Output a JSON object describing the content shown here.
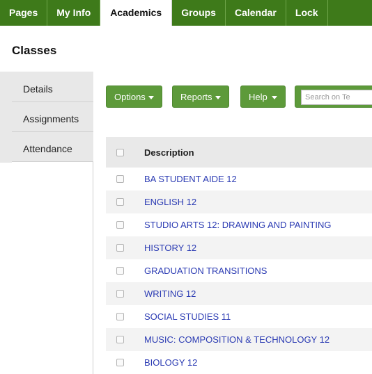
{
  "nav": {
    "tabs": [
      {
        "label": "Pages"
      },
      {
        "label": "My Info"
      },
      {
        "label": "Academics"
      },
      {
        "label": "Groups"
      },
      {
        "label": "Calendar"
      },
      {
        "label": "Lock"
      }
    ],
    "active_tab": "Academics"
  },
  "page": {
    "title": "Classes"
  },
  "sidebar": {
    "items": [
      {
        "label": "Details"
      },
      {
        "label": "Assignments"
      },
      {
        "label": "Attendance"
      }
    ]
  },
  "toolbar": {
    "options_label": "Options",
    "reports_label": "Reports",
    "help_label": "Help",
    "search_placeholder": "Search on Te"
  },
  "table": {
    "header": "Description",
    "rows": [
      {
        "description": "BA STUDENT AIDE 12"
      },
      {
        "description": "ENGLISH 12"
      },
      {
        "description": "STUDIO ARTS 12: DRAWING AND PAINTING"
      },
      {
        "description": "HISTORY 12"
      },
      {
        "description": "GRADUATION TRANSITIONS"
      },
      {
        "description": "WRITING 12"
      },
      {
        "description": "SOCIAL STUDIES 11"
      },
      {
        "description": "MUSIC: COMPOSITION & TECHNOLOGY 12"
      },
      {
        "description": "BIOLOGY 12"
      }
    ]
  },
  "colors": {
    "nav_green": "#3e7a1a",
    "button_green": "#5d9a3a",
    "link_blue": "#2b3bb3",
    "sidebar_gray": "#e8e8e8"
  }
}
